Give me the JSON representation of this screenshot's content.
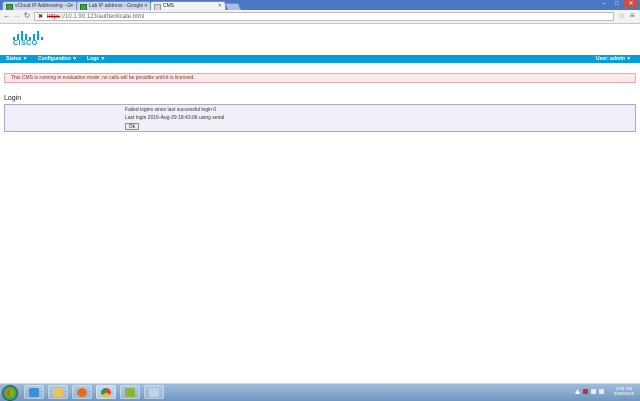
{
  "browser": {
    "tabs": [
      {
        "label": "vCloud IP Addressing - G",
        "active": false
      },
      {
        "label": "Lab IP address - Google",
        "active": false
      },
      {
        "label": "CMS",
        "active": true
      }
    ],
    "address": {
      "scheme": "https",
      "rest": "://10.1.90.123/authenticate.html"
    }
  },
  "logo": {
    "text": "CISCO"
  },
  "menu": {
    "items": [
      {
        "label": "Status"
      },
      {
        "label": "Configuration"
      },
      {
        "label": "Logs"
      }
    ],
    "user": "User: admin"
  },
  "warning": "This CMS is running in evaluation mode; no calls will be possible until it is licensed.",
  "login": {
    "heading": "Login",
    "failed_text": "Failed logins since last successful login 0",
    "last_login_text": "Last login 2016-Aug-29 18:43:06 using serial",
    "ok_label": "Ok"
  },
  "taskbar": {
    "time": "3:06 AM",
    "date": "8/30/2016"
  },
  "colors": {
    "accent": "#049fd9",
    "warning_bg": "#fde8e8"
  }
}
